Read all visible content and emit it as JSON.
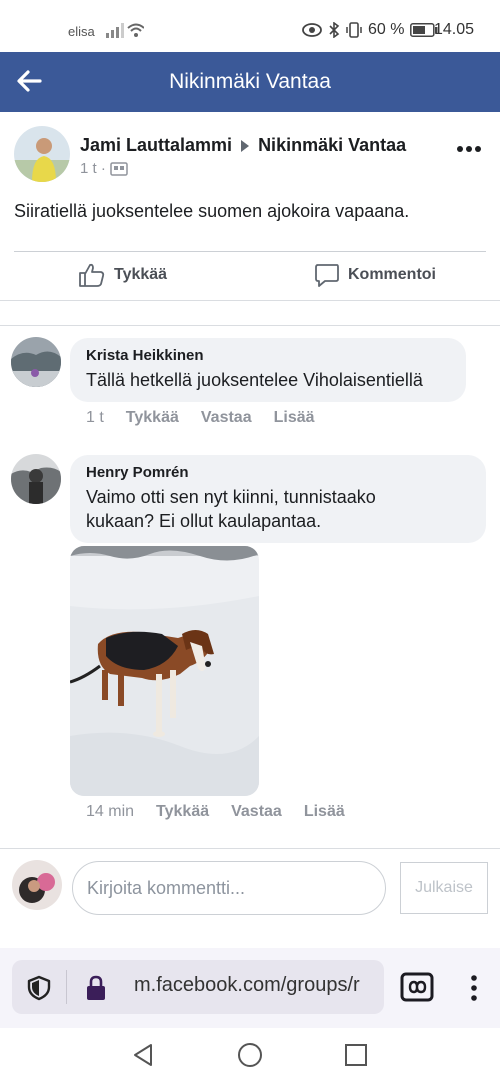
{
  "status_bar": {
    "carrier": "elisa",
    "battery": "60 %",
    "time": "14.05"
  },
  "header": {
    "title": "Nikinmäki Vantaa"
  },
  "post": {
    "author": "Jami Lauttalammi",
    "group": "Nikinmäki Vantaa",
    "time": "1 t ·",
    "text": "Siiratiellä juoksentelee suomen ajokoira vapaana.",
    "like_label": "Tykkää",
    "comment_label": "Kommentoi"
  },
  "comments": [
    {
      "name": "Krista Heikkinen",
      "text": "Tällä hetkellä juoksentelee Viholaisentiellä",
      "time": "1 t",
      "like": "Tykkää",
      "reply": "Vastaa",
      "more": "Lisää"
    },
    {
      "name": "Henry Pomrén",
      "text_line1": "Vaimo otti sen nyt kiinni, tunnistaako",
      "text_line2": "kukaan? Ei ollut kaulapantaa.",
      "time": "14 min",
      "like": "Tykkää",
      "reply": "Vastaa",
      "more": "Lisää"
    }
  ],
  "composer": {
    "placeholder": "Kirjoita kommentti...",
    "publish": "Julkaise"
  },
  "browser": {
    "url": "m.facebook.com/groups/r"
  },
  "colors": {
    "header_bg": "#3b5998",
    "bubble_bg": "#f0f2f5",
    "muted_text": "#90949c"
  },
  "icons": [
    "back-arrow-icon",
    "more-dots-icon",
    "like-thumb-icon",
    "comment-icon",
    "shield-icon",
    "lock-icon",
    "tabs-icon",
    "kebab-menu-icon",
    "nav-back-icon",
    "nav-home-icon",
    "nav-recents-icon"
  ]
}
